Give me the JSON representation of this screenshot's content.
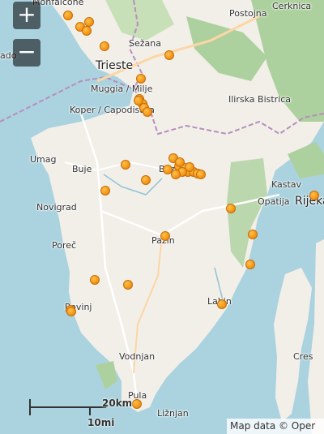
{
  "controls": {
    "zoom_in": "+",
    "zoom_out": "−"
  },
  "places": [
    {
      "id": "monfalcone",
      "label": "Monfalcone"
    },
    {
      "id": "postojna",
      "label": "Postojna"
    },
    {
      "id": "cerknica",
      "label": "Cerknica"
    },
    {
      "id": "sezana",
      "label": "Sežana"
    },
    {
      "id": "trieste",
      "label": "Trieste"
    },
    {
      "id": "grado",
      "label": "ado"
    },
    {
      "id": "muggia",
      "label": "Muggia / Milje"
    },
    {
      "id": "koper",
      "label": "Koper / Capodistria"
    },
    {
      "id": "ilirska",
      "label": "Ilirska Bistrica"
    },
    {
      "id": "umag",
      "label": "Umag"
    },
    {
      "id": "buje",
      "label": "Buje"
    },
    {
      "id": "buzet",
      "label": "Buzet"
    },
    {
      "id": "kastav",
      "label": "Kastav"
    },
    {
      "id": "rijeka",
      "label": "Rijeka"
    },
    {
      "id": "opatija",
      "label": "Opatija"
    },
    {
      "id": "novigrad",
      "label": "Novigrad"
    },
    {
      "id": "porec",
      "label": "Poreč"
    },
    {
      "id": "pazin",
      "label": "Pazin"
    },
    {
      "id": "rovinj",
      "label": "Rovinj"
    },
    {
      "id": "labin",
      "label": "Labin"
    },
    {
      "id": "vodnjan",
      "label": "Vodnjan"
    },
    {
      "id": "cres",
      "label": "Cres"
    },
    {
      "id": "pula",
      "label": "Pula"
    },
    {
      "id": "liznjan",
      "label": "Ližnjan"
    }
  ],
  "markers_count": 38,
  "scale": {
    "metric": "20km",
    "imperial": "10mi"
  },
  "attribution": "Map data © Oper",
  "colors": {
    "sea": "#aad3df",
    "land": "#f2efe9",
    "forest": "#add19e",
    "border": "#b88ebd",
    "road": "#ffffff",
    "marker": "#f59a1a"
  }
}
